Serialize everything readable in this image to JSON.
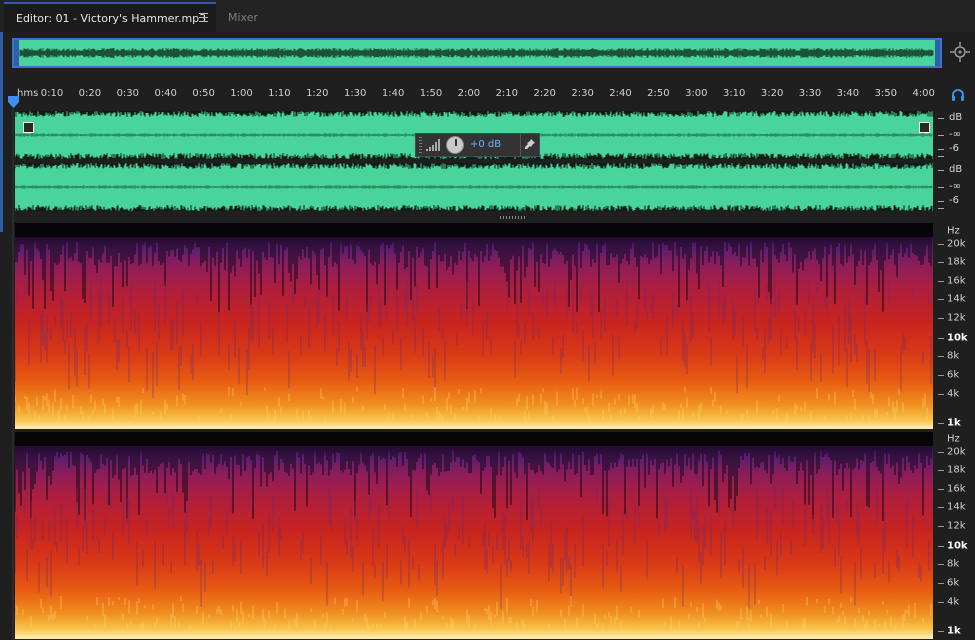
{
  "tabs": {
    "editor_label": "Editor: 01 - Victory's Hammer.mp3",
    "mixer_label": "Mixer"
  },
  "ruler": {
    "unit": "hms",
    "ticks": [
      "0:10",
      "0:20",
      "0:30",
      "0:40",
      "0:50",
      "1:00",
      "1:10",
      "1:20",
      "1:30",
      "1:40",
      "1:50",
      "2:00",
      "2:10",
      "2:20",
      "2:30",
      "2:40",
      "2:50",
      "3:00",
      "3:10",
      "3:20",
      "3:30",
      "3:40",
      "3:50",
      "4:00"
    ]
  },
  "hud": {
    "volume_value": "+0 dB"
  },
  "amplitude_scale": {
    "unit": "dB",
    "labels": [
      "-∞",
      "-6"
    ]
  },
  "frequency_scale": {
    "unit": "Hz",
    "labels": [
      {
        "text": "20k",
        "bold": false
      },
      {
        "text": "18k",
        "bold": false
      },
      {
        "text": "16k",
        "bold": false
      },
      {
        "text": "14k",
        "bold": false
      },
      {
        "text": "12k",
        "bold": false
      },
      {
        "text": "10k",
        "bold": true
      },
      {
        "text": "8k",
        "bold": false
      },
      {
        "text": "6k",
        "bold": false
      },
      {
        "text": "4k",
        "bold": false
      },
      {
        "text": "1k",
        "bold": true
      }
    ]
  },
  "colors": {
    "waveform_bg": "#49d49b",
    "waveform_line": "#0b1a12",
    "selection_accent": "#2e5fa8",
    "hud_value": "#6fb2ff"
  },
  "icons": [
    "menu-icon",
    "zoom-icon",
    "headphone-icon",
    "playhead-icon",
    "fade-handle-icon",
    "volume-bars-icon",
    "volume-knob-icon",
    "pin-icon"
  ]
}
